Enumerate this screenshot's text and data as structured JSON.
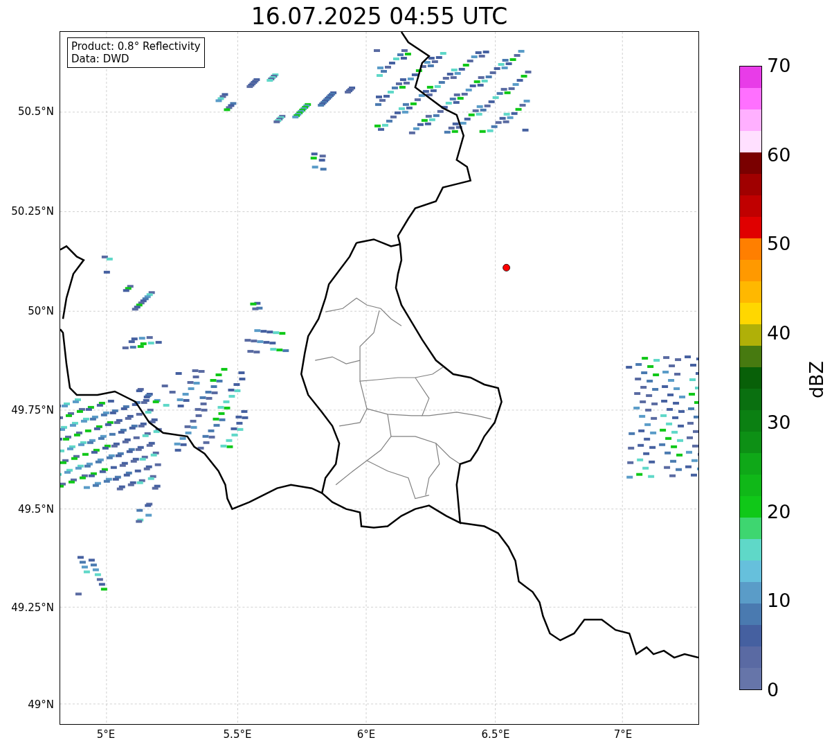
{
  "title": "16.07.2025 04:55 UTC",
  "info_box": {
    "lines": [
      "Product: 0.8° Reflectivity",
      "Data: DWD"
    ]
  },
  "y_ticks": [
    "50.5°N",
    "50.25°N",
    "50°N",
    "49.75°N",
    "49.5°N",
    "49.25°N",
    "49°N"
  ],
  "x_ticks": [
    "5°E",
    "5.5°E",
    "6°E",
    "6.5°E",
    "7°E"
  ],
  "colorbar": {
    "label": "dBZ",
    "ticks": [
      "70",
      "60",
      "50",
      "40",
      "30",
      "20",
      "10",
      "0"
    ],
    "segments": [
      {
        "color": "#6675a9"
      },
      {
        "color": "#5a6aa3"
      },
      {
        "color": "#4560a0"
      },
      {
        "color": "#4a7ab0"
      },
      {
        "color": "#5a9cc8"
      },
      {
        "color": "#66c0dc"
      },
      {
        "color": "#5fd8c8"
      },
      {
        "color": "#3ed670"
      },
      {
        "color": "#10c818"
      },
      {
        "color": "#10b818"
      },
      {
        "color": "#0fa818"
      },
      {
        "color": "#0d9015"
      },
      {
        "color": "#0b8012"
      },
      {
        "color": "#0a7010"
      },
      {
        "color": "#086008"
      },
      {
        "color": "#477a10"
      },
      {
        "color": "#b0b008"
      },
      {
        "color": "#ffd700"
      },
      {
        "color": "#ffb800"
      },
      {
        "color": "#ff9900"
      },
      {
        "color": "#ff7f00"
      },
      {
        "color": "#e00000"
      },
      {
        "color": "#c00000"
      },
      {
        "color": "#a00000"
      },
      {
        "color": "#7a0000"
      },
      {
        "color": "#ffe0ff"
      },
      {
        "color": "#ffb0ff"
      },
      {
        "color": "#ff70ff"
      },
      {
        "color": "#e83ce8"
      }
    ]
  }
}
